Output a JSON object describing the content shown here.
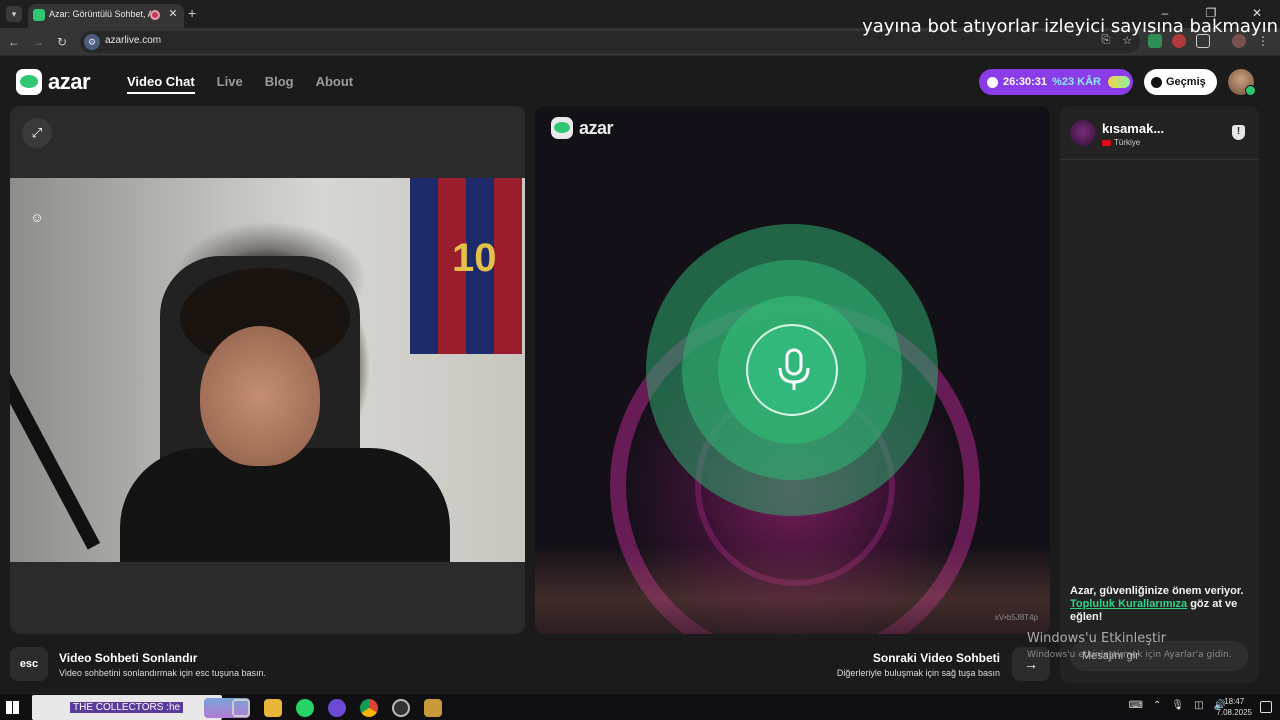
{
  "browser": {
    "tab_title": "Azar: Görüntülü Sohbet, Ar",
    "url": "azarlive.com",
    "overlay_caption": "yayına bot atıyorlar izleyici sayısına bakmayın"
  },
  "header": {
    "logo_text": "azar",
    "nav": [
      "Video Chat",
      "Live",
      "Blog",
      "About"
    ],
    "timer": "26:30:31",
    "discount": "%23 KÂR",
    "history_label": "Geçmiş"
  },
  "stranger": {
    "logo_text": "azar",
    "session_id": "xV•b5J8T4p"
  },
  "chat": {
    "partner_name": "kısamak...",
    "partner_country": "Türkiye",
    "safety_message": "Azar, güvenliğinize önem veriyor.",
    "safety_link": "Topluluk Kurallarımıza",
    "safety_suffix": " göz at ve eğlen!",
    "input_placeholder": "Mesajını gir"
  },
  "actions": {
    "esc_key": "esc",
    "end_title": "Video Sohbeti Sonlandır",
    "end_desc": "Video sohbetini sonlandırmak için esc tuşuna basın.",
    "next_title": "Sonraki Video Sohbeti",
    "next_desc": "Diğerleriyle buluşmak için sağ tuşa basın"
  },
  "windows": {
    "activate_title": "Windows'u Etkinleştir",
    "activate_desc": "Windows'u etkinleştirmek için Ayarlar'a gidin.",
    "search_text": "THE COLLECTORS :he",
    "time": "18:47",
    "date": "7.08.2025"
  },
  "colors": {
    "accent_green": "#2fc771",
    "promo_purple": "#8a3ce8",
    "link_green": "#2fd586"
  }
}
